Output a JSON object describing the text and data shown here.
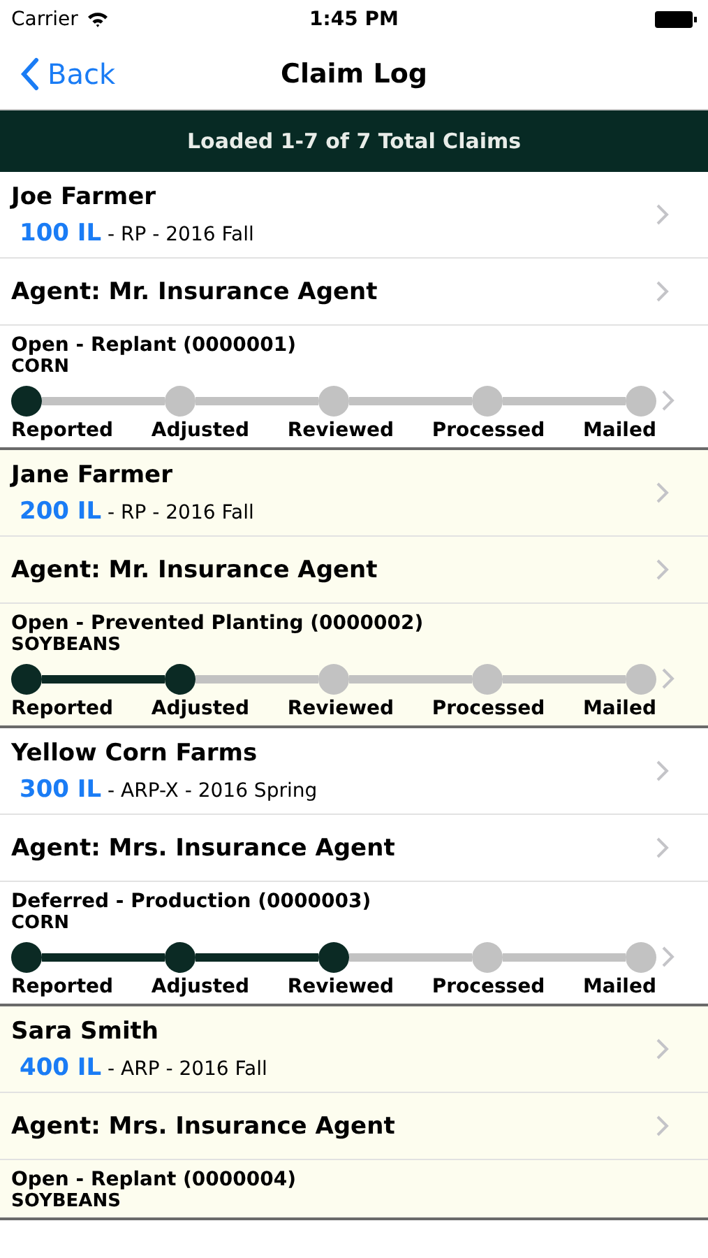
{
  "status_bar": {
    "carrier": "Carrier",
    "time": "1:45 PM"
  },
  "nav": {
    "back": "Back",
    "title": "Claim Log"
  },
  "banner": "Loaded 1-7 of 7 Total Claims",
  "claims": [
    {
      "shaded": false,
      "name": "Joe Farmer",
      "policy": "100 IL",
      "detail": " - RP - 2016 Fall",
      "agent": "Agent: Mr. Insurance Agent",
      "status": "Open - Replant (0000001)",
      "crop": "CORN",
      "stages": [
        {
          "label": "Reported",
          "reached": true
        },
        {
          "label": "Adjusted",
          "reached": false
        },
        {
          "label": "Reviewed",
          "reached": false
        },
        {
          "label": "Processed",
          "reached": false
        },
        {
          "label": "Mailed",
          "reached": false
        }
      ]
    },
    {
      "shaded": true,
      "name": "Jane Farmer",
      "policy": "200 IL",
      "detail": " - RP - 2016 Fall",
      "agent": "Agent: Mr. Insurance Agent",
      "status": "Open - Prevented Planting (0000002)",
      "crop": "SOYBEANS",
      "stages": [
        {
          "label": "Reported",
          "reached": true
        },
        {
          "label": "Adjusted",
          "reached": true
        },
        {
          "label": "Reviewed",
          "reached": false
        },
        {
          "label": "Processed",
          "reached": false
        },
        {
          "label": "Mailed",
          "reached": false
        }
      ]
    },
    {
      "shaded": false,
      "name": "Yellow Corn Farms",
      "policy": "300 IL",
      "detail": " - ARP-X - 2016 Spring",
      "agent": "Agent: Mrs. Insurance Agent",
      "status": "Deferred - Production (0000003)",
      "crop": "CORN",
      "stages": [
        {
          "label": "Reported",
          "reached": true
        },
        {
          "label": "Adjusted",
          "reached": true
        },
        {
          "label": "Reviewed",
          "reached": true
        },
        {
          "label": "Processed",
          "reached": false
        },
        {
          "label": "Mailed",
          "reached": false
        }
      ]
    },
    {
      "shaded": true,
      "name": "Sara Smith",
      "policy": "400 IL",
      "detail": " - ARP - 2016 Fall",
      "agent": "Agent: Mrs. Insurance Agent",
      "status": "Open - Replant (0000004)",
      "crop": "SOYBEANS"
    }
  ]
}
